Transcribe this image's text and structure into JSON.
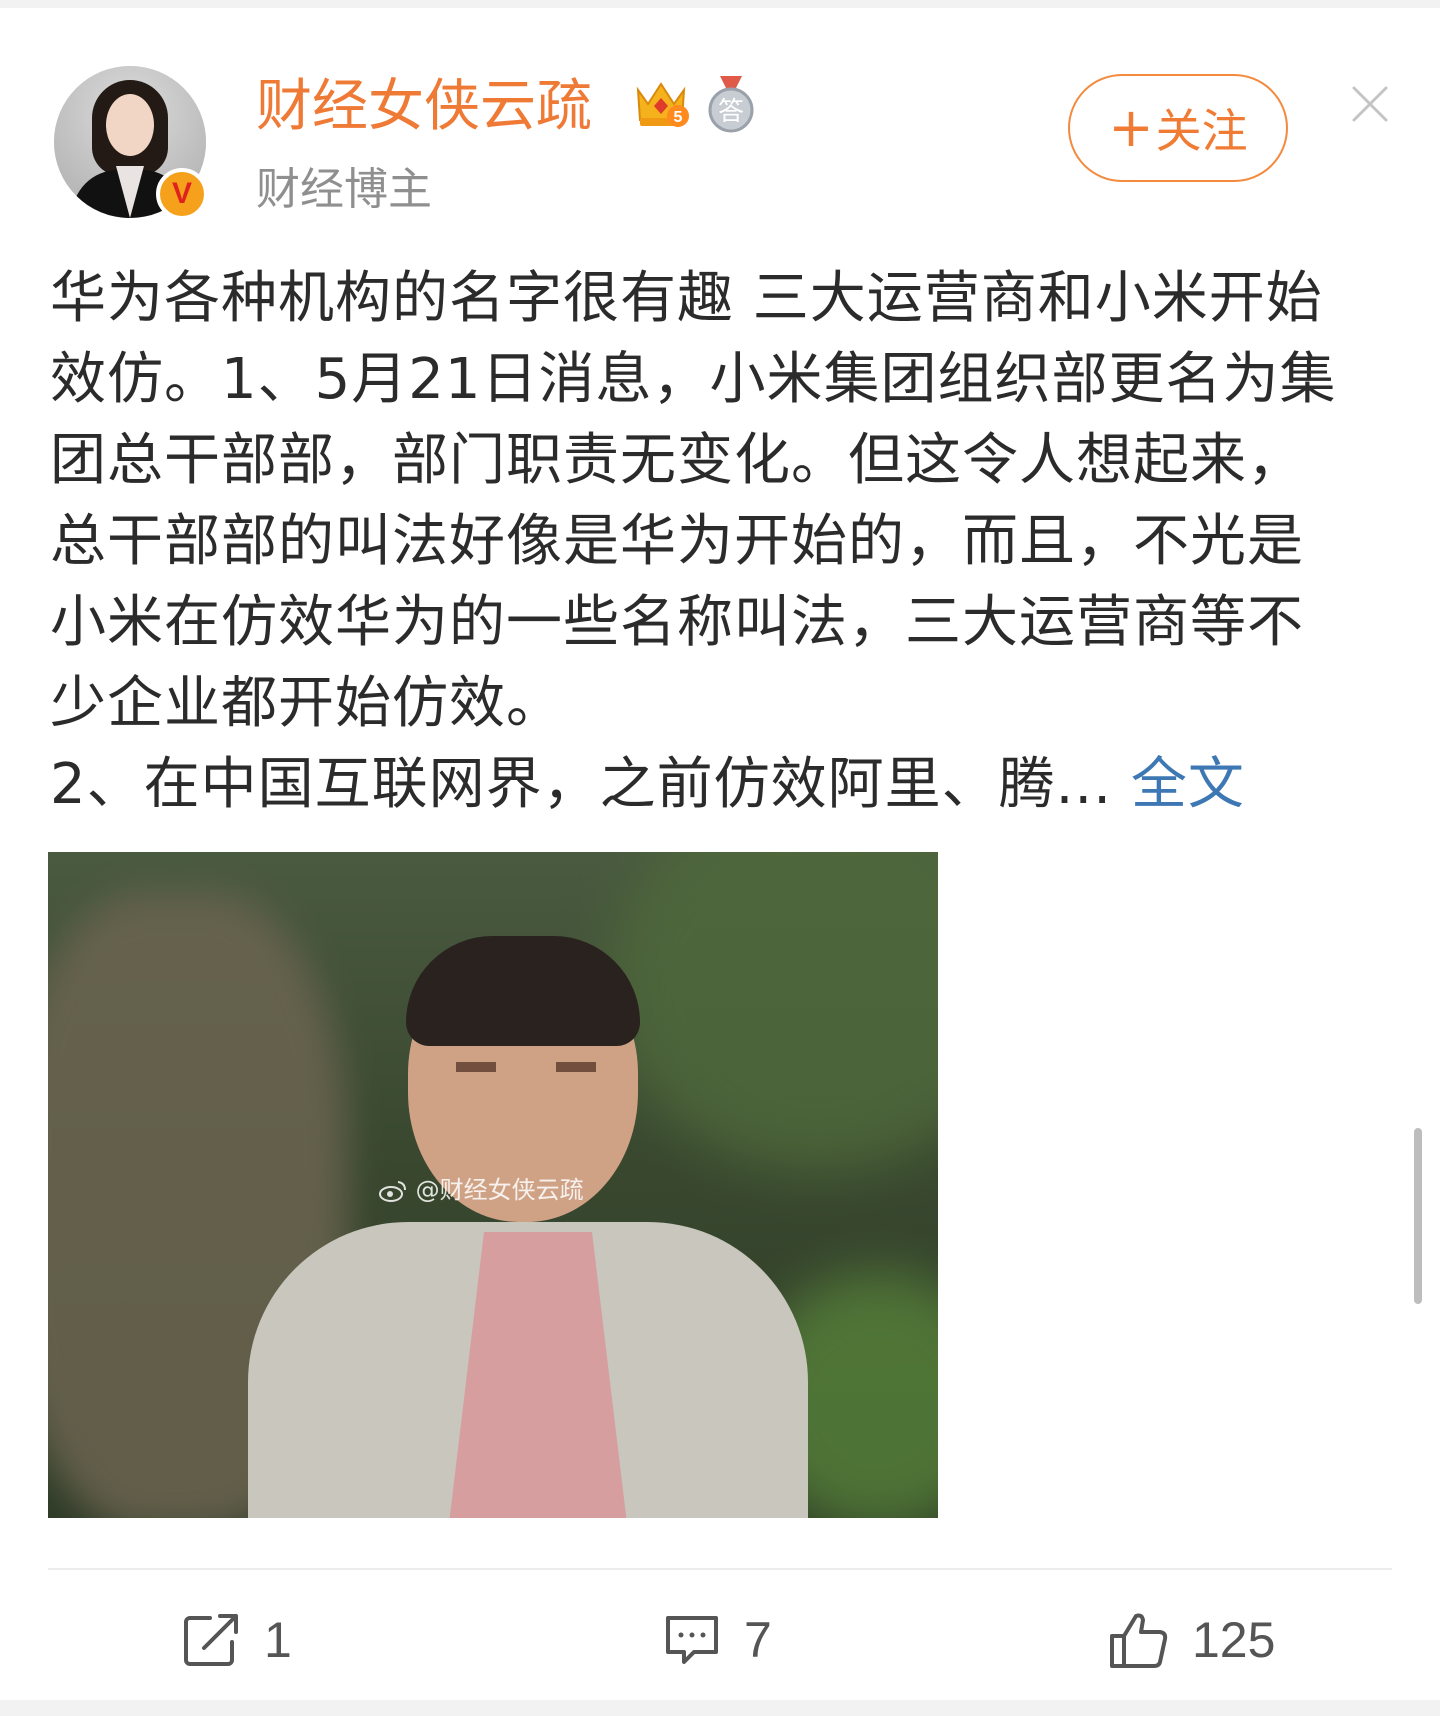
{
  "header": {
    "username": "财经女侠云疏",
    "subtitle": "财经博主",
    "follow_label": "关注",
    "crown_level": "5",
    "medal_label": "答"
  },
  "post": {
    "lines": [
      "华为各种机构的名字很有趣 三大运营商和小米开始",
      "效仿。1、5月21日消息，小米集团组织部更名为集",
      "团总干部部，部门职责无变化。但这令人想起来，",
      "总干部部的叫法好像是华为开始的，而且，不光是",
      "小米在仿效华为的一些名称叫法，三大运营商等不",
      "少企业都开始仿效。",
      "2、在中国互联网界，之前仿效阿里、腾..."
    ],
    "more_label": "全文",
    "image_watermark": "@财经女侠云疏"
  },
  "actions": {
    "repost_count": "1",
    "comment_count": "7",
    "like_count": "125"
  },
  "colors": {
    "accent_orange": "#ef7a36",
    "link_blue": "#3e78b4",
    "text": "#2b2b2b",
    "muted": "#8f8f8f"
  },
  "icons": [
    "verified-v-icon",
    "crown-badge-icon",
    "medal-badge-icon",
    "close-icon",
    "repost-icon",
    "comment-icon",
    "like-icon",
    "weibo-logo-icon"
  ]
}
